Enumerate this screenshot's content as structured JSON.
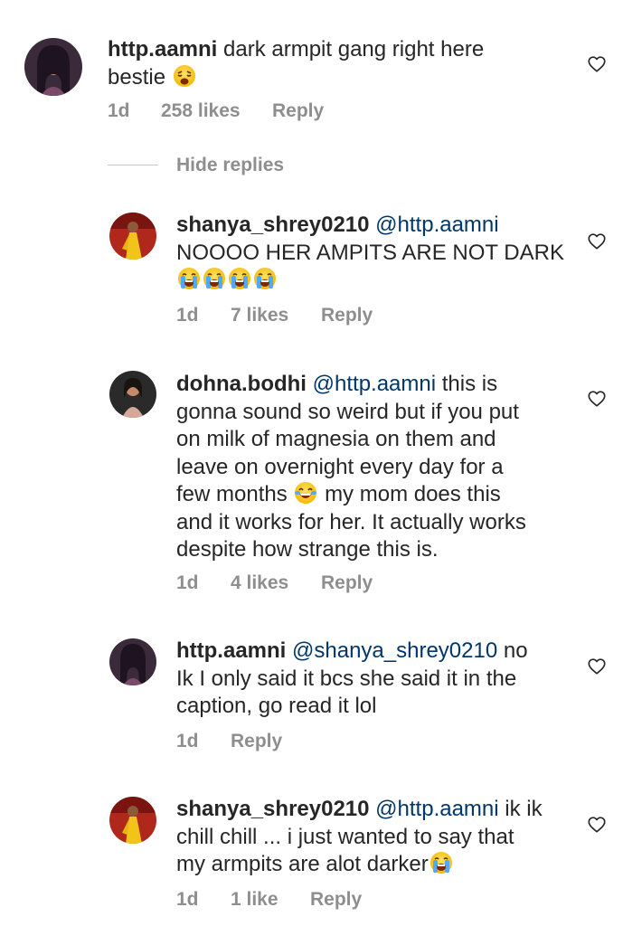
{
  "comments": [
    {
      "username": "http.aamni",
      "mention": "",
      "text_lines": [
        "dark armpit gang right here",
        "bestie"
      ],
      "emoji": "weary-face",
      "time": "1d",
      "likes": "258 likes",
      "reply": "Reply"
    },
    {
      "username": "shanya_shrey0210",
      "mention": "@http.aamni",
      "text_lines": [
        "NOOOO HER AMPITS ARE NOT DARK"
      ],
      "emoji": "loudly-crying-face x4",
      "time": "1d",
      "likes": "7 likes",
      "reply": "Reply"
    },
    {
      "username": "dohna.bodhi",
      "mention": "@http.aamni",
      "line1_rest": "this is",
      "text_lines": [
        "gonna sound so weird but if you put",
        "on milk of magnesia on them and",
        "leave on overnight every day for a",
        "few months",
        "my mom does this",
        "and it works for her. It actually works",
        "despite how strange this is."
      ],
      "emoji": "tears-of-joy-face",
      "time": "1d",
      "likes": "4 likes",
      "reply": "Reply"
    },
    {
      "username": "http.aamni",
      "mention": "@shanya_shrey0210",
      "line1_rest": "no",
      "text_lines": [
        "Ik I only said it bcs she said it in the",
        "caption, go read it lol"
      ],
      "time": "1d",
      "reply": "Reply"
    },
    {
      "username": "shanya_shrey0210",
      "mention": "@http.aamni",
      "line1_rest": "ik ik",
      "text_lines": [
        "chill chill ... i just wanted to say that",
        "my armpits are alot darker"
      ],
      "emoji": "loudly-crying-face",
      "time": "1d",
      "likes": "1 like",
      "reply": "Reply"
    }
  ],
  "hide_replies": "Hide replies",
  "icons": {
    "like": "heart-outline-icon"
  },
  "colors": {
    "text": "#262626",
    "meta": "#8e8e8e",
    "mention": "#00376b"
  }
}
